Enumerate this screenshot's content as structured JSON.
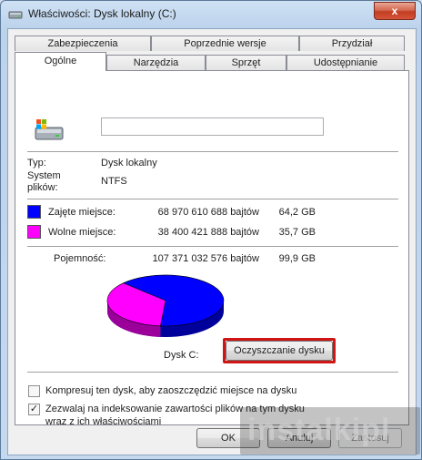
{
  "window": {
    "title": "Właściwości: Dysk lokalny (C:)",
    "close_glyph": "x"
  },
  "tabs_row1": [
    {
      "label": "Zabezpieczenia"
    },
    {
      "label": "Poprzednie wersje"
    },
    {
      "label": "Przydział"
    }
  ],
  "tabs_row2": [
    {
      "label": "Ogólne",
      "active": true
    },
    {
      "label": "Narzędzia"
    },
    {
      "label": "Sprzęt"
    },
    {
      "label": "Udostępnianie"
    }
  ],
  "general": {
    "name_value": "",
    "type_label": "Typ:",
    "type_value": "Dysk lokalny",
    "fs_label": "System\nplików:",
    "fs_value": "NTFS",
    "used_label": "Zajęte miejsce:",
    "used_bytes": "68 970 610 688 bajtów",
    "used_size": "64,2 GB",
    "used_color": "#0000ff",
    "free_label": "Wolne miejsce:",
    "free_bytes": "38 400 421 888 bajtów",
    "free_size": "35,7 GB",
    "free_color": "#ff00ff",
    "capacity_label": "Pojemność:",
    "capacity_bytes": "107 371 032 576 bajtów",
    "capacity_size": "99,9 GB",
    "drive_caption": "Dysk C:",
    "cleanup_button": "Oczyszczanie dysku",
    "compress_label": "Kompresuj ten dysk, aby zaoszczędzić miejsce na dysku",
    "compress_checked": false,
    "index_label_line1": "Zezwalaj na indeksowanie zawartości plików na tym dysku",
    "index_label_line2": "wraz z ich właściwościami",
    "index_checked": true
  },
  "chart_data": {
    "type": "pie",
    "categories": [
      "Zajęte miejsce",
      "Wolne miejsce"
    ],
    "values": [
      64.2,
      35.7
    ],
    "colors": [
      "#0000ff",
      "#ff00ff"
    ]
  },
  "footer": {
    "ok": "OK",
    "cancel": "Anuluj",
    "apply": "Zastosuj"
  },
  "watermark": {
    "text1": "instalki",
    "text2": "pl"
  }
}
